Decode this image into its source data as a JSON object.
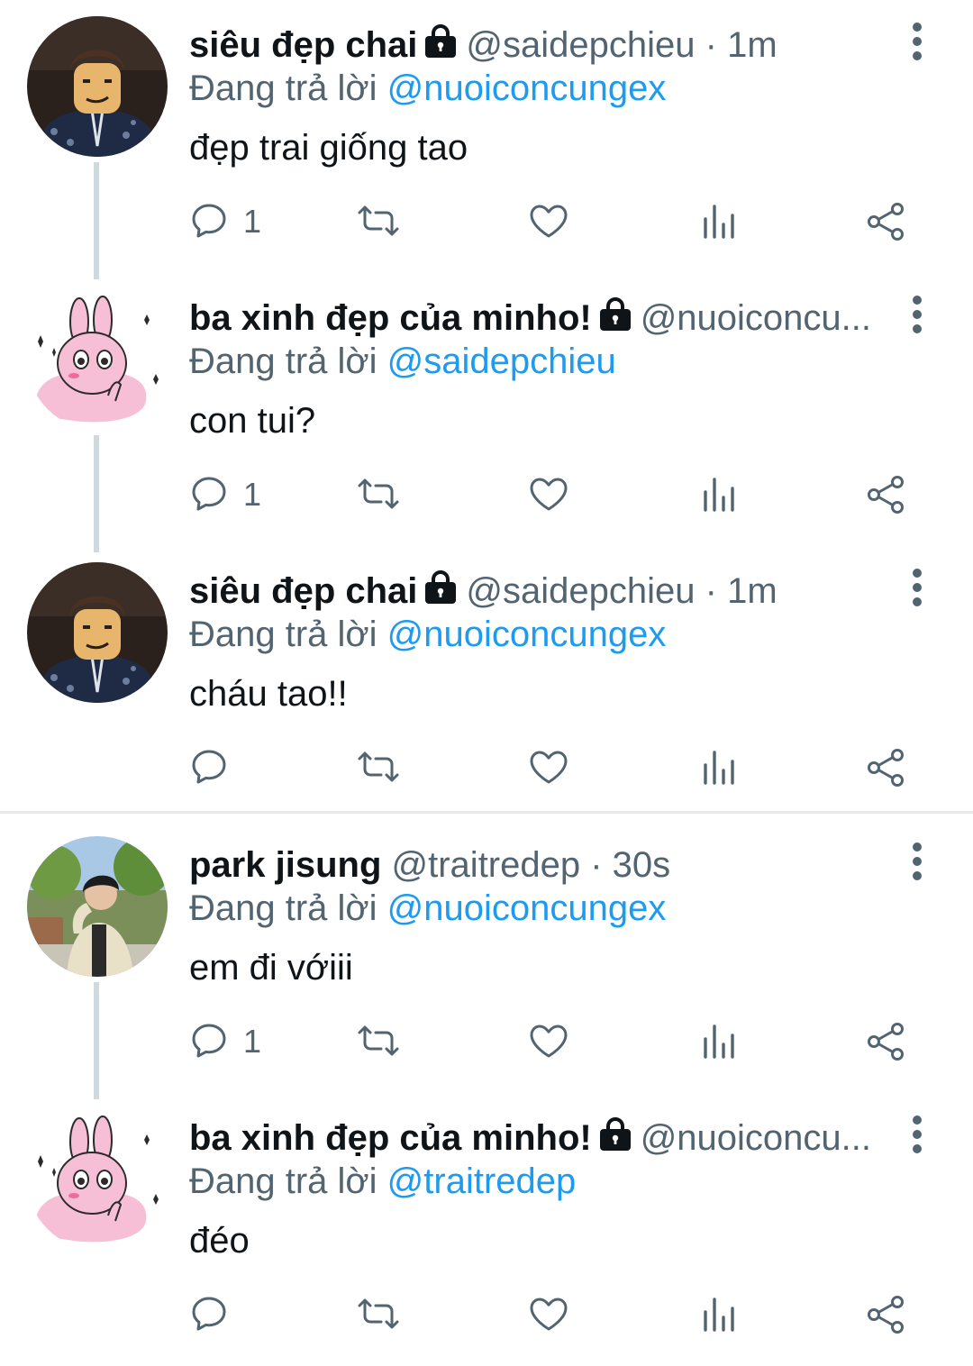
{
  "colors": {
    "text": "#0f1419",
    "muted": "#536471",
    "link": "#1d9bf0",
    "line": "#cfd9de"
  },
  "icons": [
    "reply-icon",
    "retweet-icon",
    "like-icon",
    "views-icon",
    "share-icon",
    "lock-icon",
    "more-icon"
  ],
  "tweets": [
    {
      "name": "siêu đẹp chai",
      "protected": true,
      "handle": "@saidepchieu",
      "sep": " · ",
      "time": "1m",
      "reply_prefix": "Đang trả lời ",
      "reply_to": "@nuoiconcungex",
      "text": "đẹp trai giống tao",
      "reply_count": "1"
    },
    {
      "name": "ba xinh đẹp của minho!",
      "protected": true,
      "handle": "@nuoiconcu...",
      "sep": "",
      "time": "",
      "reply_prefix": "Đang trả lời ",
      "reply_to": "@saidepchieu",
      "text": "con tui?",
      "reply_count": "1"
    },
    {
      "name": "siêu đẹp chai",
      "protected": true,
      "handle": "@saidepchieu",
      "sep": " · ",
      "time": "1m",
      "reply_prefix": "Đang trả lời ",
      "reply_to": "@nuoiconcungex",
      "text": "cháu tao!!",
      "reply_count": ""
    },
    {
      "name": "park jisung",
      "protected": false,
      "handle": "@traitredep",
      "sep": " · ",
      "time": "30s",
      "reply_prefix": "Đang trả lời ",
      "reply_to": "@nuoiconcungex",
      "text": "em đi vớiii",
      "reply_count": "1"
    },
    {
      "name": "ba xinh đẹp của minho!",
      "protected": true,
      "handle": "@nuoiconcu...",
      "sep": "",
      "time": "",
      "reply_prefix": "Đang trả lời ",
      "reply_to": "@traitredep",
      "text": "đéo",
      "reply_count": ""
    }
  ]
}
